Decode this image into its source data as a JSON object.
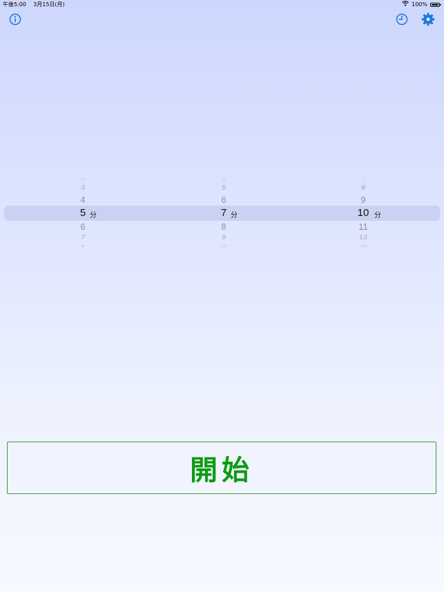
{
  "status_bar": {
    "time": "午後5:00",
    "date": "3月15日(月)",
    "battery": "100%"
  },
  "toolbar": {
    "info_icon": "info-icon",
    "history_icon": "clock-icon",
    "settings_icon": "gear-icon",
    "accent_color": "#1a7ad9"
  },
  "pickers": [
    {
      "above": [
        "2",
        "3",
        "4"
      ],
      "selected": "5",
      "unit": "分",
      "below": [
        "6",
        "7",
        "8"
      ]
    },
    {
      "above": [
        "4",
        "5",
        "6"
      ],
      "selected": "7",
      "unit": "分",
      "below": [
        "8",
        "9",
        "10"
      ]
    },
    {
      "above": [
        "7",
        "8",
        "9"
      ],
      "selected": "10",
      "unit": "分",
      "below": [
        "11",
        "12",
        "13"
      ]
    }
  ],
  "start_button": {
    "label": "開始",
    "color": "#0e9b12"
  }
}
